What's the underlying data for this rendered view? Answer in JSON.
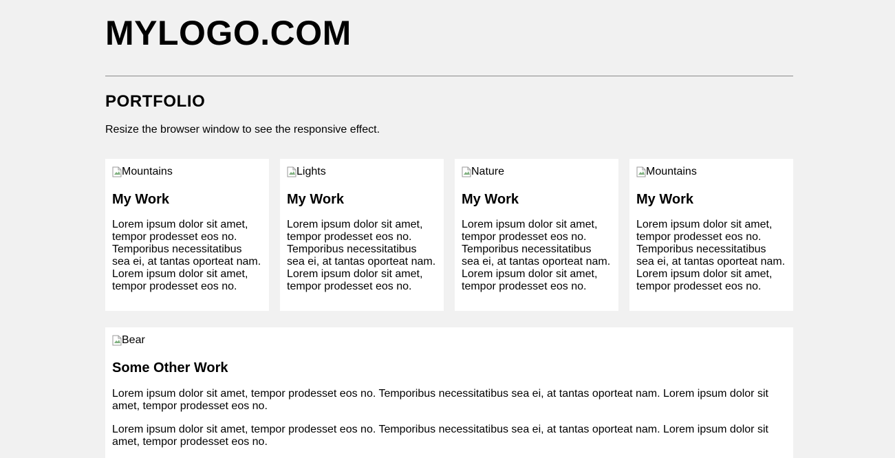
{
  "header": {
    "logo": "MYLOGO.COM"
  },
  "section": {
    "title": "PORTFOLIO",
    "intro": "Resize the browser window to see the responsive effect."
  },
  "cards": [
    {
      "image_alt": "Mountains",
      "title": "My Work",
      "text": "Lorem ipsum dolor sit amet, tempor prodesset eos no. Temporibus necessitatibus sea ei, at tantas oporteat nam. Lorem ipsum dolor sit amet, tempor prodesset eos no."
    },
    {
      "image_alt": "Lights",
      "title": "My Work",
      "text": "Lorem ipsum dolor sit amet, tempor prodesset eos no. Temporibus necessitatibus sea ei, at tantas oporteat nam. Lorem ipsum dolor sit amet, tempor prodesset eos no."
    },
    {
      "image_alt": "Nature",
      "title": "My Work",
      "text": "Lorem ipsum dolor sit amet, tempor prodesset eos no. Temporibus necessitatibus sea ei, at tantas oporteat nam. Lorem ipsum dolor sit amet, tempor prodesset eos no."
    },
    {
      "image_alt": "Mountains",
      "title": "My Work",
      "text": "Lorem ipsum dolor sit amet, tempor prodesset eos no. Temporibus necessitatibus sea ei, at tantas oporteat nam. Lorem ipsum dolor sit amet, tempor prodesset eos no."
    }
  ],
  "wide_card": {
    "image_alt": "Bear",
    "title": "Some Other Work",
    "paragraphs": [
      "Lorem ipsum dolor sit amet, tempor prodesset eos no. Temporibus necessitatibus sea ei, at tantas oporteat nam. Lorem ipsum dolor sit amet, tempor prodesset eos no.",
      "Lorem ipsum dolor sit amet, tempor prodesset eos no. Temporibus necessitatibus sea ei, at tantas oporteat nam. Lorem ipsum dolor sit amet, tempor prodesset eos no."
    ]
  },
  "colors": {
    "page_background": "#f1f1f1",
    "card_background": "#ffffff",
    "divider": "#8a8a8a"
  },
  "icons": {
    "broken_image": "broken-image-icon"
  }
}
